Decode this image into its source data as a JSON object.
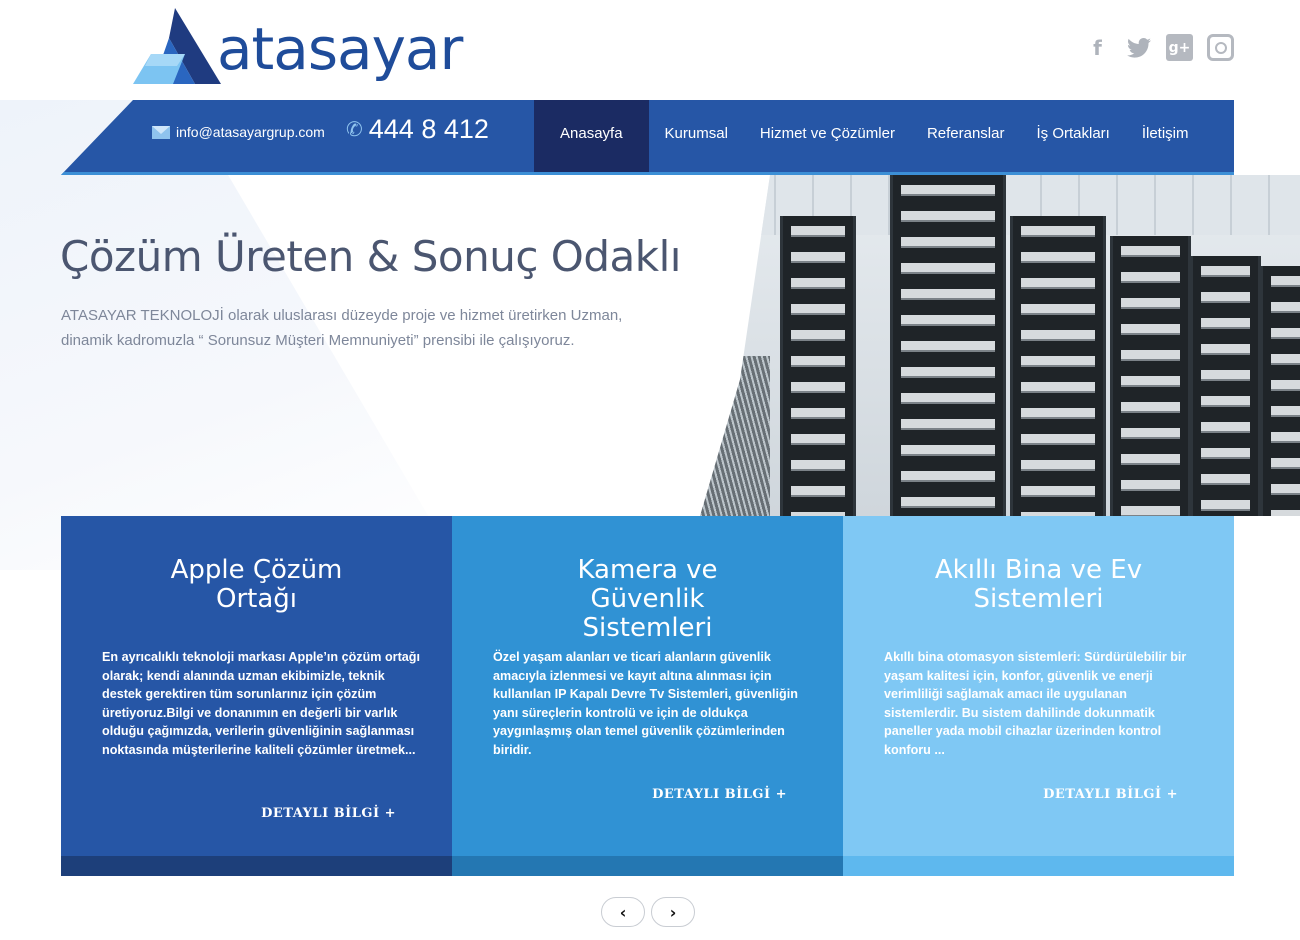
{
  "brand": {
    "name": "atasayar",
    "color": "#1f4c9a"
  },
  "social": [
    {
      "name": "facebook-icon",
      "glyph": "f"
    },
    {
      "name": "twitter-icon",
      "glyph": "🐦"
    },
    {
      "name": "google-plus-icon",
      "glyph": "g+"
    },
    {
      "name": "instagram-icon",
      "glyph": ""
    }
  ],
  "header": {
    "email": "info@atasayargrup.com",
    "phone": "444 8 412",
    "menu": [
      "Anasayfa",
      "Kurumsal",
      "Hizmet ve Çözümler",
      "Referanslar",
      "İş Ortakları",
      "İletişim"
    ],
    "active_index": 0
  },
  "hero": {
    "title": "Çözüm Üreten & Sonuç Odaklı",
    "text": "ATASAYAR TEKNOLOJİ olarak uluslarası düzeyde proje ve hizmet üretirken Uzman, dinamik kadromuzla “ Sorunsuz Müşteri Memnuniyeti” prensibi ile çalışıyoruz."
  },
  "cards": [
    {
      "title": "Apple Çözüm Ortağı",
      "text": "En ayrıcalıklı teknoloji markası Apple’ın çözüm ortağı olarak; kendi alanında uzman ekibimizle, teknik destek gerektiren tüm sorunlarınız için çözüm üretiyoruz.Bilgi ve donanımın en değerli bir varlık olduğu çağımızda, verilerin güvenliğinin sağlanması noktasında müşterilerine kaliteli çözümler üretmek...",
      "button": "DETAYLI BİLGİ +",
      "color": "#2656a6"
    },
    {
      "title": "Kamera ve Güvenlik Sistemleri",
      "text": "Özel yaşam alanları  ve ticari alanların güvenlik amacıyla izlenmesi ve kayıt altına alınması için kullanılan IP Kapalı Devre Tv Sistemleri, güvenliğin yanı süreçlerin kontrolü ve için de oldukça yaygınlaşmış olan temel güvenlik çözümlerinden biridir.",
      "button": "DETAYLI BİLGİ +",
      "color": "#3092d4"
    },
    {
      "title": "Akıllı Bina ve Ev Sistemleri",
      "text": "Akıllı bina otomasyon sistemleri: Sürdürülebilir bir yaşam kalitesi için, konfor, güvenlik ve enerji verimliliği sağlamak amacı ile uygulanan sistemlerdir. Bu sistem dahilinde dokunmatik paneller yada mobil cihazlar üzerinden kontrol konforu ...",
      "button": "DETAYLI BİLGİ +",
      "color": "#7fc8f4"
    }
  ],
  "pager": {
    "prev": "‹",
    "next": "›"
  }
}
